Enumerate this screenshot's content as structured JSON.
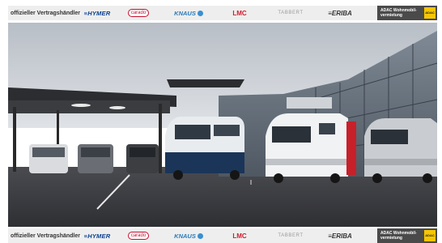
{
  "brand_bar": {
    "dealer_text": "offizieller Vertragshändler",
    "brands": {
      "hymer": "≡HYMER",
      "carado": "carado",
      "knaus": "KNAUS",
      "lmc": "LMC",
      "tabbert": "TABBERT",
      "eriba": "≡ERIBA"
    },
    "adac_text": "ADAC Wohnmobil-vermietung",
    "adac_badge": "ADAC"
  },
  "photo": {
    "subject": "RV dealership lot with camper vans parked under a carport and in front of a glass showroom",
    "van_plates": [
      "",
      "",
      ""
    ],
    "colors": {
      "sky": "#c9cdd2",
      "asphalt": "#3a3b3f",
      "roof": "#2b2d30",
      "hymer_blue": "#0b3f8f",
      "lmc_red": "#d01c2c",
      "adac_yellow": "#f7c600"
    }
  }
}
